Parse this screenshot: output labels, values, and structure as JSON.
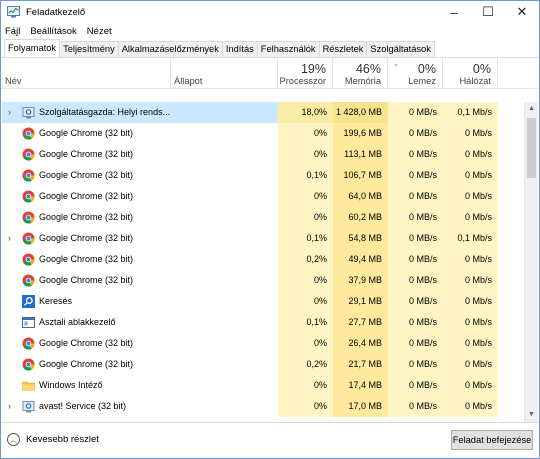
{
  "window": {
    "title": "Feladatkezelő",
    "minimize": "–",
    "maximize": "☐",
    "close": "✕"
  },
  "menu": [
    {
      "label": "Fájl"
    },
    {
      "label": "Beállítások"
    },
    {
      "label": "Nézet"
    }
  ],
  "tabs": [
    {
      "label": "Folyamatok",
      "active": true
    },
    {
      "label": "Teljesítmény"
    },
    {
      "label": "Alkalmazáselőzmények"
    },
    {
      "label": "Indítás"
    },
    {
      "label": "Felhasználók"
    },
    {
      "label": "Részletek"
    },
    {
      "label": "Szolgáltatások"
    }
  ],
  "columns": {
    "name": "Név",
    "status": "Állapot",
    "cpu": {
      "label": "Processzor",
      "pct": "19%"
    },
    "mem": {
      "label": "Memória",
      "pct": "46%"
    },
    "disk": {
      "label": "Lemez",
      "pct": "0%"
    },
    "net": {
      "label": "Hálózat",
      "pct": "0%"
    }
  },
  "rows": [
    {
      "name": "Szolgáltatásgazda: Helyi rends...",
      "icon": "service-host-icon",
      "expand": true,
      "selected": true,
      "cpu": "18,0%",
      "mem": "1 428,0 MB",
      "disk": "0 MB/s",
      "net": "0,1 Mb/s"
    },
    {
      "name": "Google Chrome (32 bit)",
      "icon": "chrome-icon",
      "expand": false,
      "cpu": "0%",
      "mem": "199,6 MB",
      "disk": "0 MB/s",
      "net": "0 Mb/s"
    },
    {
      "name": "Google Chrome (32 bit)",
      "icon": "chrome-icon",
      "expand": false,
      "cpu": "0%",
      "mem": "113,1 MB",
      "disk": "0 MB/s",
      "net": "0 Mb/s"
    },
    {
      "name": "Google Chrome (32 bit)",
      "icon": "chrome-icon",
      "expand": false,
      "cpu": "0,1%",
      "mem": "106,7 MB",
      "disk": "0 MB/s",
      "net": "0 Mb/s"
    },
    {
      "name": "Google Chrome (32 bit)",
      "icon": "chrome-icon",
      "expand": false,
      "cpu": "0%",
      "mem": "64,0 MB",
      "disk": "0 MB/s",
      "net": "0 Mb/s"
    },
    {
      "name": "Google Chrome (32 bit)",
      "icon": "chrome-icon",
      "expand": false,
      "cpu": "0%",
      "mem": "60,2 MB",
      "disk": "0 MB/s",
      "net": "0 Mb/s"
    },
    {
      "name": "Google Chrome (32 bit)",
      "icon": "chrome-icon",
      "expand": true,
      "cpu": "0,1%",
      "mem": "54,8 MB",
      "disk": "0 MB/s",
      "net": "0,1 Mb/s"
    },
    {
      "name": "Google Chrome (32 bit)",
      "icon": "chrome-icon",
      "expand": false,
      "cpu": "0,2%",
      "mem": "49,4 MB",
      "disk": "0 MB/s",
      "net": "0 Mb/s"
    },
    {
      "name": "Google Chrome (32 bit)",
      "icon": "chrome-icon",
      "expand": false,
      "cpu": "0%",
      "mem": "37,9 MB",
      "disk": "0 MB/s",
      "net": "0 Mb/s"
    },
    {
      "name": "Keresés",
      "icon": "search-app-icon",
      "expand": false,
      "cpu": "0%",
      "mem": "29,1 MB",
      "disk": "0 MB/s",
      "net": "0 Mb/s"
    },
    {
      "name": "Asztali ablakkezelő",
      "icon": "window-manager-icon",
      "expand": false,
      "cpu": "0,1%",
      "mem": "27,7 MB",
      "disk": "0 MB/s",
      "net": "0 Mb/s"
    },
    {
      "name": "Google Chrome (32 bit)",
      "icon": "chrome-icon",
      "expand": false,
      "cpu": "0%",
      "mem": "26,4 MB",
      "disk": "0 MB/s",
      "net": "0 Mb/s"
    },
    {
      "name": "Google Chrome (32 bit)",
      "icon": "chrome-icon",
      "expand": false,
      "cpu": "0,2%",
      "mem": "21,7 MB",
      "disk": "0 MB/s",
      "net": "0 Mb/s"
    },
    {
      "name": "Windows Intéző",
      "icon": "explorer-icon",
      "expand": false,
      "cpu": "0%",
      "mem": "17,4 MB",
      "disk": "0 MB/s",
      "net": "0 Mb/s"
    },
    {
      "name": "avast! Service (32 bit)",
      "icon": "service-icon",
      "expand": true,
      "cpu": "0%",
      "mem": "17,0 MB",
      "disk": "0 MB/s",
      "net": "0 Mb/s"
    }
  ],
  "footer": {
    "fewer_details": "Kevesebb részlet",
    "end_task": "Feladat befejezése"
  }
}
